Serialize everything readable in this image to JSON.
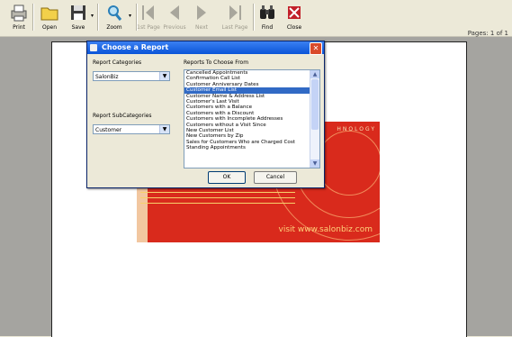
{
  "toolbar": {
    "print": "Print",
    "open": "Open",
    "save": "Save",
    "zoom": "Zoom",
    "first_page": "1st Page",
    "previous": "Previous",
    "next": "Next",
    "last_page": "Last Page",
    "find": "Find",
    "close": "Close"
  },
  "pages_label": "Pages: 1 of 1",
  "dialog": {
    "title": "Choose a Report",
    "categories_label": "Report Categories",
    "category_value": "SalonBiz",
    "subcategories_label": "Report SubCategories",
    "subcategory_value": "Customer",
    "reports_label": "Reports To Choose From",
    "reports": [
      "Cancelled Appointments",
      "Confirmation Call List",
      "Customer Anniversary Dates",
      "Customer Email List",
      "Customer Name & Address List",
      "Customer's Last Visit",
      "Customers with a Balance",
      "Customers with a Discount",
      "Customers with Incomplete Addresses",
      "Customers without a Visit Since",
      "New Customer List",
      "New Customers by Zip",
      "Sales for Customers Who are Charged Cost",
      "Standing Appointments"
    ],
    "selected_index": 3,
    "ok_label": "OK",
    "cancel_label": "Cancel"
  },
  "banner": {
    "tech_text": "HNOLOGY",
    "url": "visit www.salonbiz.com"
  },
  "colors": {
    "titlebar": "#0a54d8",
    "selection": "#316ac5",
    "banner_red": "#d92a1c"
  }
}
